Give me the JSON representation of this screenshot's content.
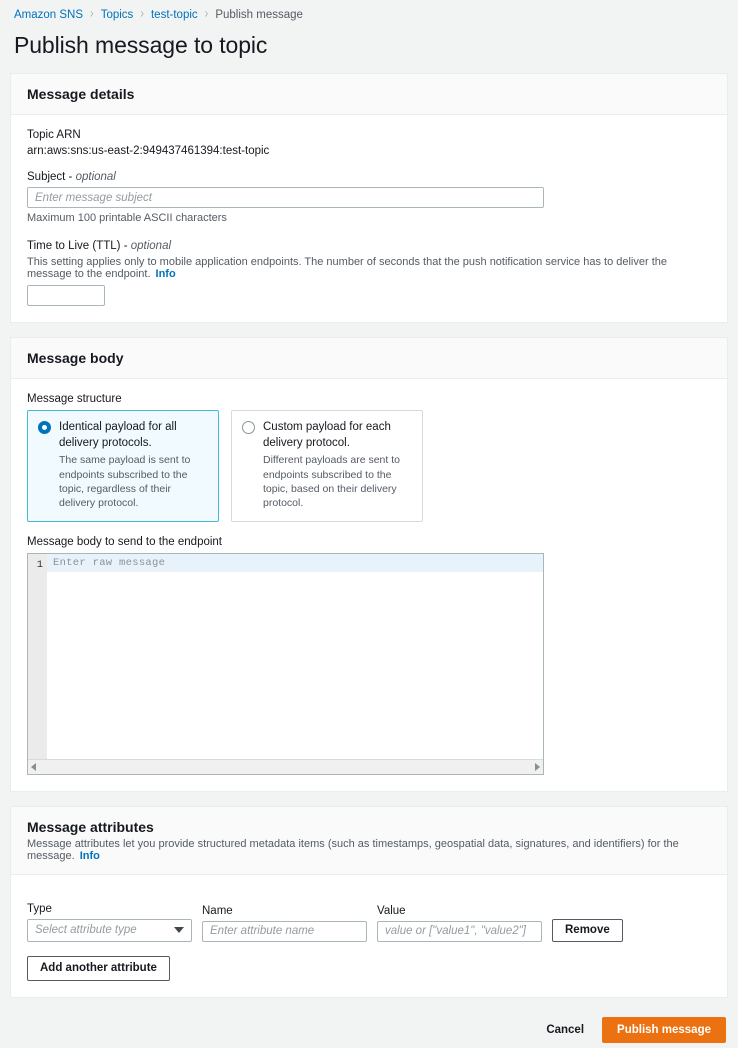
{
  "breadcrumb": {
    "items": [
      {
        "label": "Amazon SNS",
        "current": false
      },
      {
        "label": "Topics",
        "current": false
      },
      {
        "label": "test-topic",
        "current": false
      },
      {
        "label": "Publish message",
        "current": true
      }
    ],
    "separator": "›"
  },
  "page": {
    "title": "Publish message to topic"
  },
  "message_details": {
    "header": "Message details",
    "topic_arn_label": "Topic ARN",
    "topic_arn_value": "arn:aws:sns:us-east-2:949437461394:test-topic",
    "subject_label": "Subject - ",
    "subject_label_optional": "optional",
    "subject_placeholder": "Enter message subject",
    "subject_value": "",
    "subject_hint": "Maximum 100 printable ASCII characters",
    "ttl_label": "Time to Live (TTL) - ",
    "ttl_label_optional": "optional",
    "ttl_description": "This setting applies only to mobile application endpoints. The number of seconds that the push notification service has to deliver the message to the endpoint.",
    "ttl_info": "Info",
    "ttl_value": ""
  },
  "message_body": {
    "header": "Message body",
    "structure_label": "Message structure",
    "options": [
      {
        "title": "Identical payload for all delivery protocols.",
        "subtitle": "The same payload is sent to endpoints subscribed to the topic, regardless of their delivery protocol.",
        "selected": true
      },
      {
        "title": "Custom payload for each delivery protocol.",
        "subtitle": "Different payloads are sent to endpoints subscribed to the topic, based on their delivery protocol.",
        "selected": false
      }
    ],
    "body_label": "Message body to send to the endpoint",
    "editor_line_number": "1",
    "editor_placeholder": "Enter raw message",
    "editor_value": ""
  },
  "message_attributes": {
    "header": "Message attributes",
    "description": "Message attributes let you provide structured metadata items (such as timestamps, geospatial data, signatures, and identifiers) for the message.",
    "info": "Info",
    "columns": {
      "type": "Type",
      "name": "Name",
      "value": "Value"
    },
    "type_placeholder": "Select attribute type",
    "type_value": "",
    "name_placeholder": "Enter attribute name",
    "name_value": "",
    "value_placeholder": "value or [\"value1\", \"value2\"]",
    "value_value": "",
    "remove_label": "Remove",
    "add_label": "Add another attribute"
  },
  "footer": {
    "cancel_label": "Cancel",
    "publish_label": "Publish message"
  },
  "colors": {
    "page_background": "#f2f3f3",
    "accent_link": "#0073bb",
    "primary_button": "#ec7211",
    "selected_tile_background": "#f1faff",
    "selected_tile_border": "#44b9d6",
    "text_primary": "#16191f",
    "text_secondary": "#545b64"
  }
}
